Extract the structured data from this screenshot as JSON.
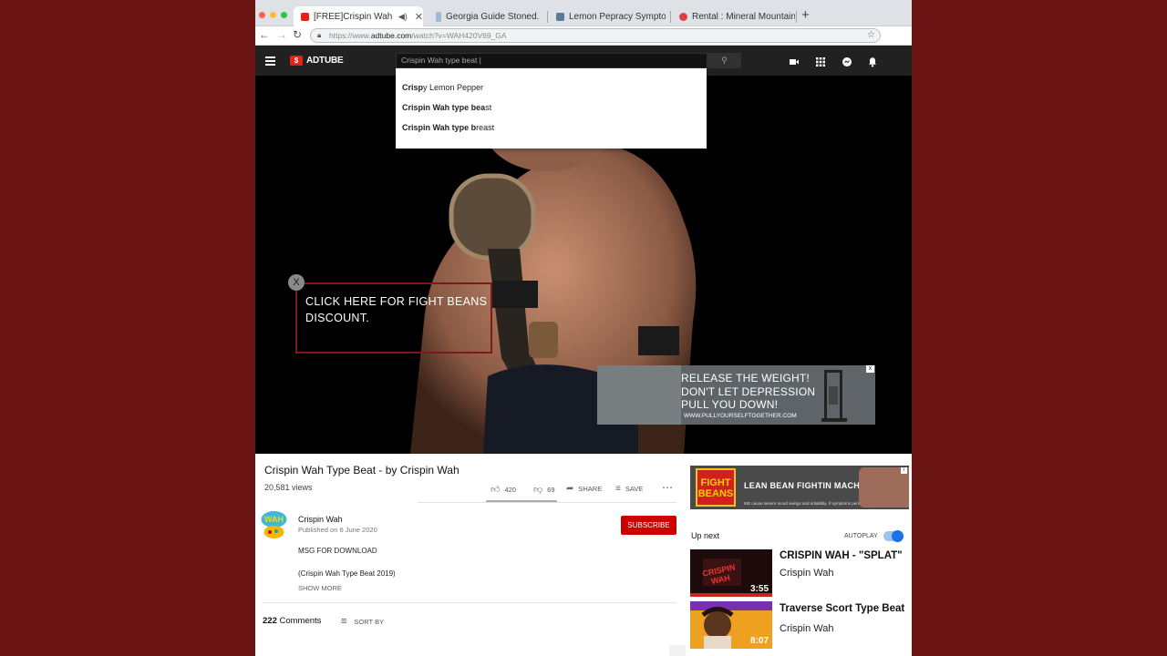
{
  "browser": {
    "tabs": [
      {
        "label": "[FREE]Crispin Wah typ",
        "active": true,
        "favicon_color": "#e62117"
      },
      {
        "label": "Georgia Guide Stoned....",
        "active": false,
        "favicon_color": "#9bb9d8"
      },
      {
        "label": "Lemon Pepracy Sympto...",
        "active": false,
        "favicon_color": "#5a7a9a"
      },
      {
        "label": "Rental : Mineral Mountain",
        "active": false,
        "favicon_color": "#d94040"
      }
    ],
    "url_prefix": "https://www.",
    "url_domain": "adtube.com",
    "url_path": "/watch?v=WAH420V69_GA"
  },
  "site": {
    "logo_mark": "$",
    "logo_text": "ADTUBE",
    "search_value": "Crispin Wah type beat |",
    "suggestions": [
      {
        "bold": "Crisp",
        "rest": "y Lemon Pepper"
      },
      {
        "bold": "Crispin Wah type bea",
        "rest": "st"
      },
      {
        "bold": "Crispin Wah type b",
        "rest": "reast"
      }
    ]
  },
  "video": {
    "ad_close": "X",
    "ad_text": "CLICK HERE FOR FIGHT BEANS DISCOUNT.",
    "banner_line1": "RELEASE THE WEIGHT!",
    "banner_line2": "DON'T LET DEPRESSION",
    "banner_line3": "PULL YOU DOWN!",
    "banner_url": "WWW.PULLYOURSELFTOGETHER.COM",
    "banner_close": "x"
  },
  "info": {
    "title": "Crispin Wah Type Beat - by Crispin Wah",
    "views": "20,581 views",
    "likes": "420",
    "dislikes": "69",
    "share": "SHARE",
    "save": "SAVE",
    "channel": "Crispin Wah",
    "published": "Published on 6 June 2020",
    "subscribe": "SUBSCRIBE",
    "desc_line1": "MSG FOR DOWNLOAD",
    "desc_line2": "(Crispin Wah Type Beat 2019)",
    "show_more": "SHOW MORE",
    "comments_count": "222",
    "comments_label": "Comments",
    "sort_by": "SORT BY"
  },
  "sidebar": {
    "ad_can_text": "FIGHT BEANS",
    "ad_title": "LEAN BEAN FIGHTIN MACHINE.",
    "ad_sub": "Mtz cause severe mood swings and irritability. If symptoms persist consult doctor",
    "up_next": "Up next",
    "autoplay": "AUTOPLAY",
    "autoplay_on": true,
    "videos": [
      {
        "title": "CRISPIN WAH - \"SPLAT\"",
        "channel": "Crispin Wah",
        "duration": "3:55"
      },
      {
        "title": "Traverse Scort Type Beat",
        "channel": "Crispin Wah",
        "duration": "8:07"
      }
    ]
  },
  "colors": {
    "page_bg": "#6b1414",
    "brand_red": "#e62117",
    "subscribe_red": "#cc0000",
    "toggle_blue": "#1a73e8"
  }
}
